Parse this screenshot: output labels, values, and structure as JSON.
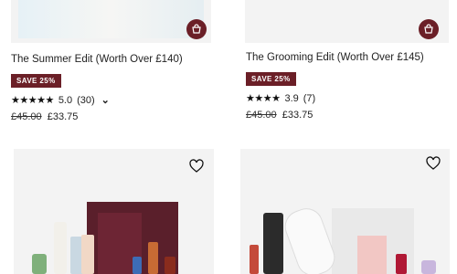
{
  "products_top": [
    {
      "title": "The Summer Edit (Worth Over £140)",
      "badge": "SAVE 25%",
      "stars": "★★★★★",
      "rating": "5.0",
      "reviews": "(30)",
      "old_price": "£45.00",
      "new_price": "£33.75",
      "icon": "basket-icon"
    },
    {
      "title": "The Grooming Edit (Worth Over £145)",
      "badge": "SAVE 25%",
      "stars": "★★★★",
      "rating": "3.9",
      "reviews": "(7)",
      "old_price": "£45.00",
      "new_price": "£33.75",
      "icon": "basket-icon"
    }
  ],
  "products_bottom": [
    {
      "icon": "heart-icon",
      "image": "beauty-box-product-image"
    },
    {
      "icon": "heart-icon",
      "image": "bridesmaid-box-product-image"
    }
  ],
  "colors": {
    "accent": "#6b1f27",
    "image_bg": "#f3f3f3"
  }
}
